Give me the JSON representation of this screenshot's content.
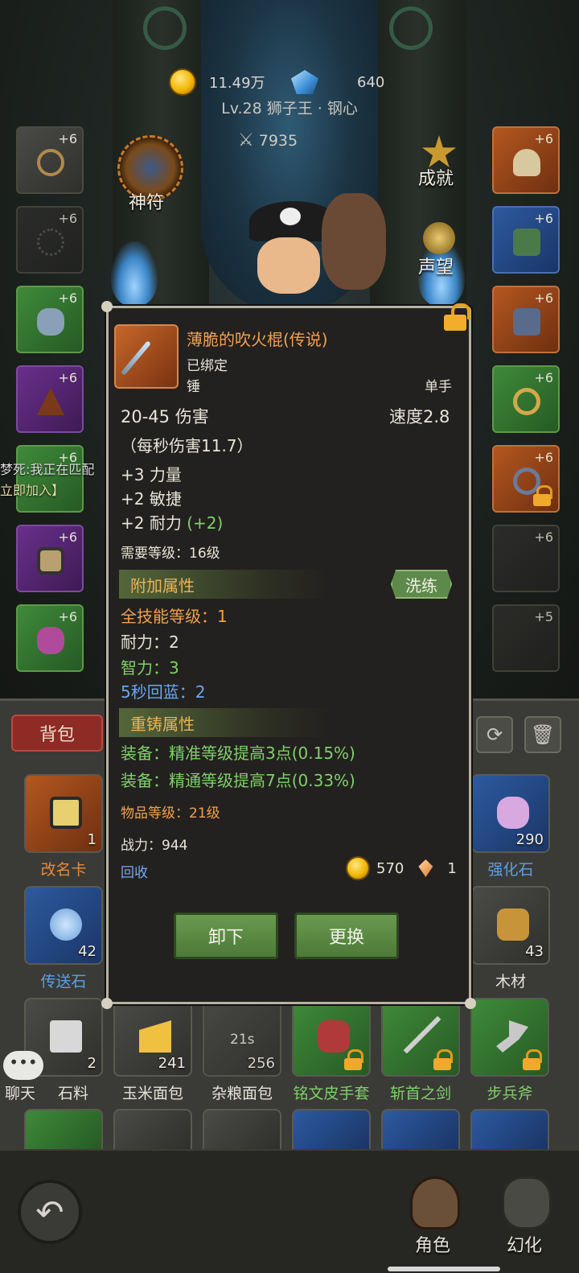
{
  "header": {
    "gold": "11.49万",
    "gems": "640",
    "character": "Lv.28 狮子王 · 钢心",
    "power": "7935",
    "talisman_label": "神符",
    "achievement_label": "成就",
    "reputation_label": "声望"
  },
  "left_slots": [
    "+6",
    "+6",
    "+6",
    "+6",
    "+6",
    "+6",
    "+6"
  ],
  "right_slots": [
    "+6",
    "+6",
    "+6",
    "+6",
    "+6",
    "+6",
    "+5"
  ],
  "chat": {
    "line1": "梦死:我正在匹配",
    "line2": "立即加入】",
    "label": "聊天"
  },
  "tooltip": {
    "name": "薄脆的吹火棍(传说)",
    "bound": "已绑定",
    "type": "锤",
    "hand": "单手",
    "damage": "20-45 伤害",
    "speed": "速度2.8",
    "dps": "（每秒伤害11.7）",
    "stat1": "+3 力量",
    "stat2": "+2 敏捷",
    "stat3": "+2 耐力",
    "stat3_bonus": "(+2)",
    "req_level": "需要等级：16级",
    "extra_title": "附加属性",
    "refine_label": "洗练",
    "extra1": "全技能等级：1",
    "extra2": "耐力：2",
    "extra3": "智力：3",
    "extra4": "5秒回蓝：2",
    "reforge_title": "重铸属性",
    "reforge1": "装备：精准等级提高3点(0.15%)",
    "reforge2": "装备：精通等级提高7点(0.33%)",
    "item_level": "物品等级：21级",
    "combat_power": "战力：944",
    "recycle": "回收",
    "recycle_gold": "570",
    "recycle_shard": "1",
    "unequip_label": "卸下",
    "replace_label": "更换"
  },
  "inventory": {
    "tab": "背包",
    "row1": [
      {
        "label": "改名卡",
        "count": "1"
      },
      {
        "label": "强化石",
        "count": "290"
      }
    ],
    "row2": [
      {
        "label": "传送石",
        "count": "42"
      },
      {
        "label": "木材",
        "count": "43"
      }
    ],
    "row3": [
      {
        "label": "石料",
        "count": "2"
      },
      {
        "label": "玉米面包",
        "count": "241"
      },
      {
        "label": "杂粮面包",
        "count": "256",
        "timer": "21s"
      },
      {
        "label": "铭文皮手套",
        "count": ""
      },
      {
        "label": "斩首之剑",
        "count": ""
      },
      {
        "label": "步兵斧",
        "count": ""
      }
    ]
  },
  "nav": {
    "character": "角色",
    "illusion": "幻化"
  },
  "colors": {
    "legendary": "#f0a050",
    "green_stat": "#7fd06a",
    "blue_stat": "#6aa8f0",
    "orange_stat": "#f0a050",
    "section": "#e9b456"
  }
}
